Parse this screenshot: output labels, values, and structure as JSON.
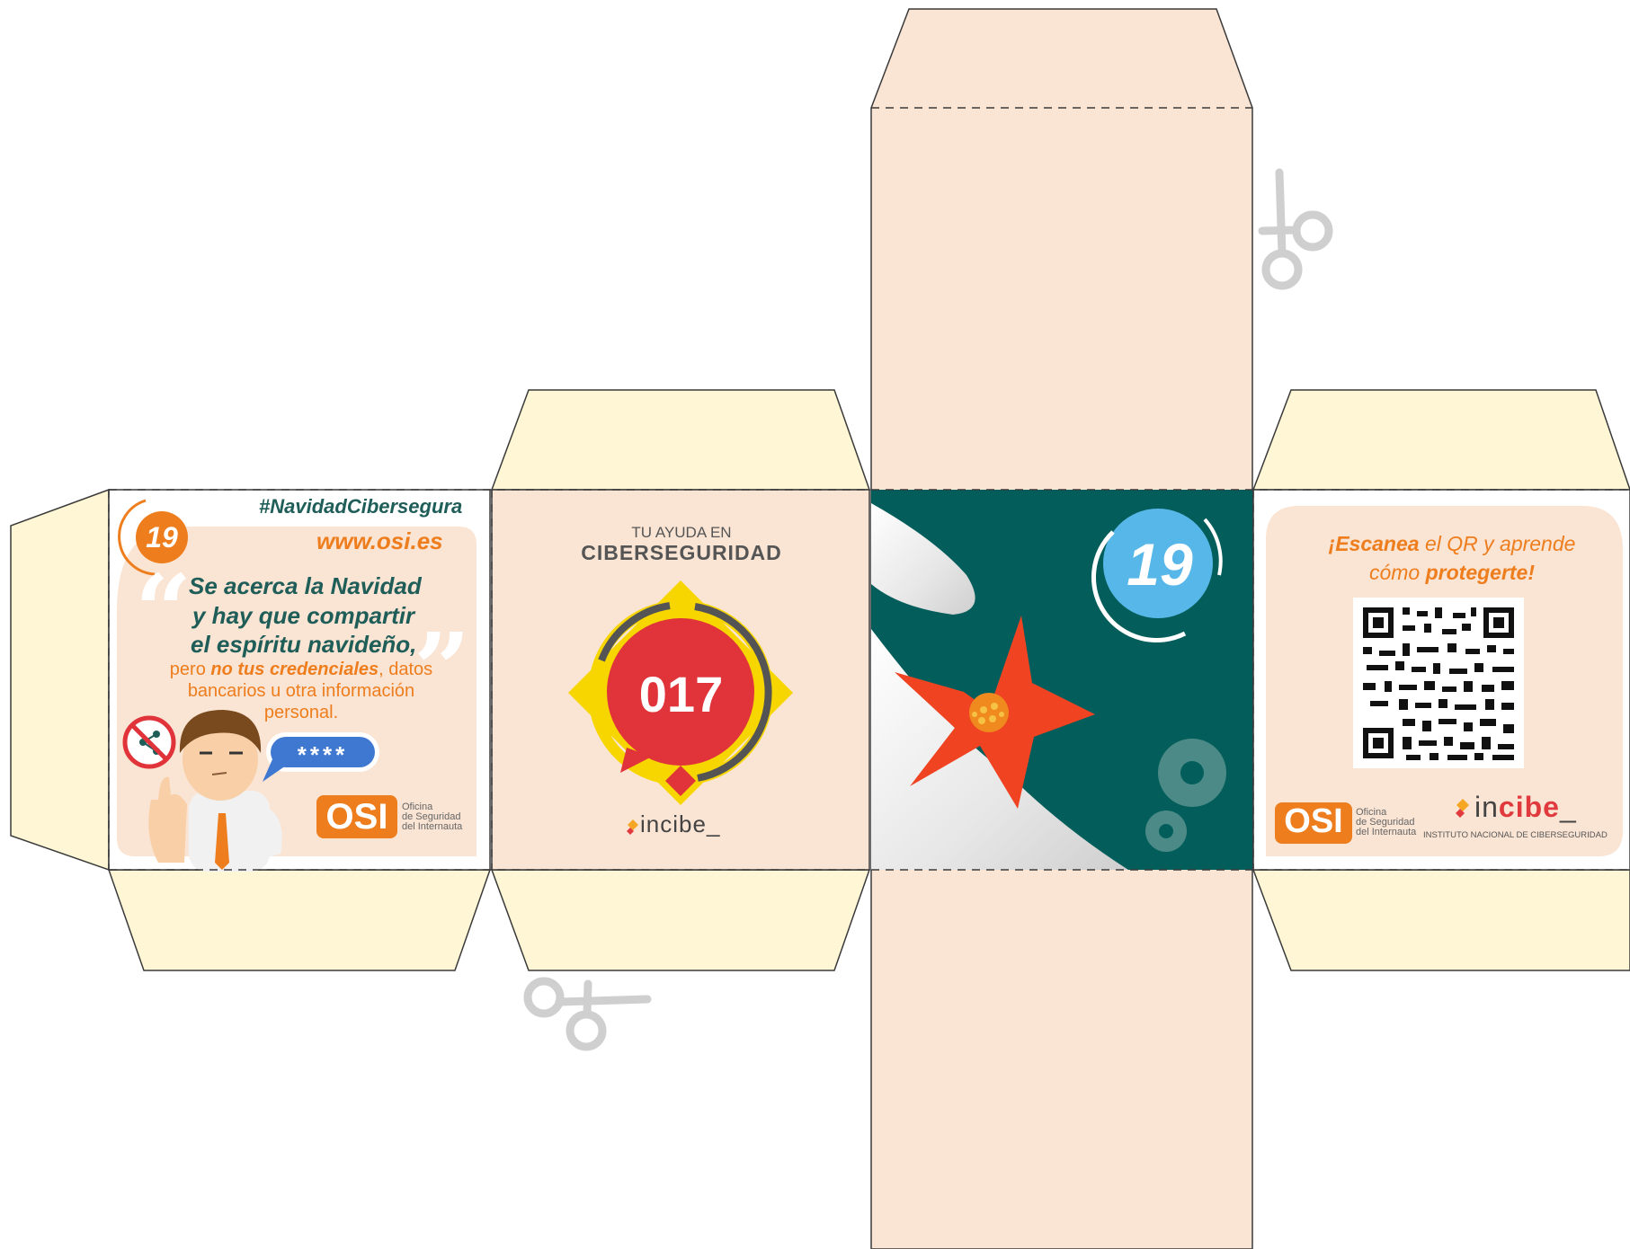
{
  "panel_left": {
    "day_number": "19",
    "hashtag": "#NavidadCibersegura",
    "url": "www.osi.es",
    "headline": [
      "Se acerca la Navidad",
      "y hay que compartir",
      "el espíritu navideño,"
    ],
    "body_pre": "pero ",
    "body_bold": "no tus credenciales",
    "body_post": ", datos",
    "body_line2": "bancarios u otra información",
    "body_line3": "personal.",
    "password_mask": "****",
    "osi_logo": "OSI",
    "osi_caption": [
      "Oficina",
      "de Seguridad",
      "del Internauta"
    ]
  },
  "panel_017": {
    "line1": "TU AYUDA EN",
    "line2": "CIBERSEGURIDAD",
    "number": "017",
    "logo_a": "in",
    "logo_b": "cibe",
    "logo_c": "_"
  },
  "panel_front": {
    "day_number": "19"
  },
  "panel_qr": {
    "head_1a": "¡Escanea",
    "head_1b": " el QR y aprende",
    "head_2a": "cómo ",
    "head_2b": "protegerte!",
    "osi_logo": "OSI",
    "osi_caption": [
      "Oficina",
      "de Seguridad",
      "del Internauta"
    ],
    "incibe_a": "in",
    "incibe_b": "cibe",
    "incibe_c": "_",
    "incibe_sub": "INSTITUTO NACIONAL DE CIBERSEGURIDAD"
  },
  "colors": {
    "peach": "#fae4d3",
    "flap_cream": "#fef6d4",
    "teal": "#035e5b",
    "orange": "#ee7d1d",
    "green_text": "#1f5d58",
    "red": "#e0343a",
    "yellow": "#fbd800",
    "blue": "#57b7e8"
  }
}
